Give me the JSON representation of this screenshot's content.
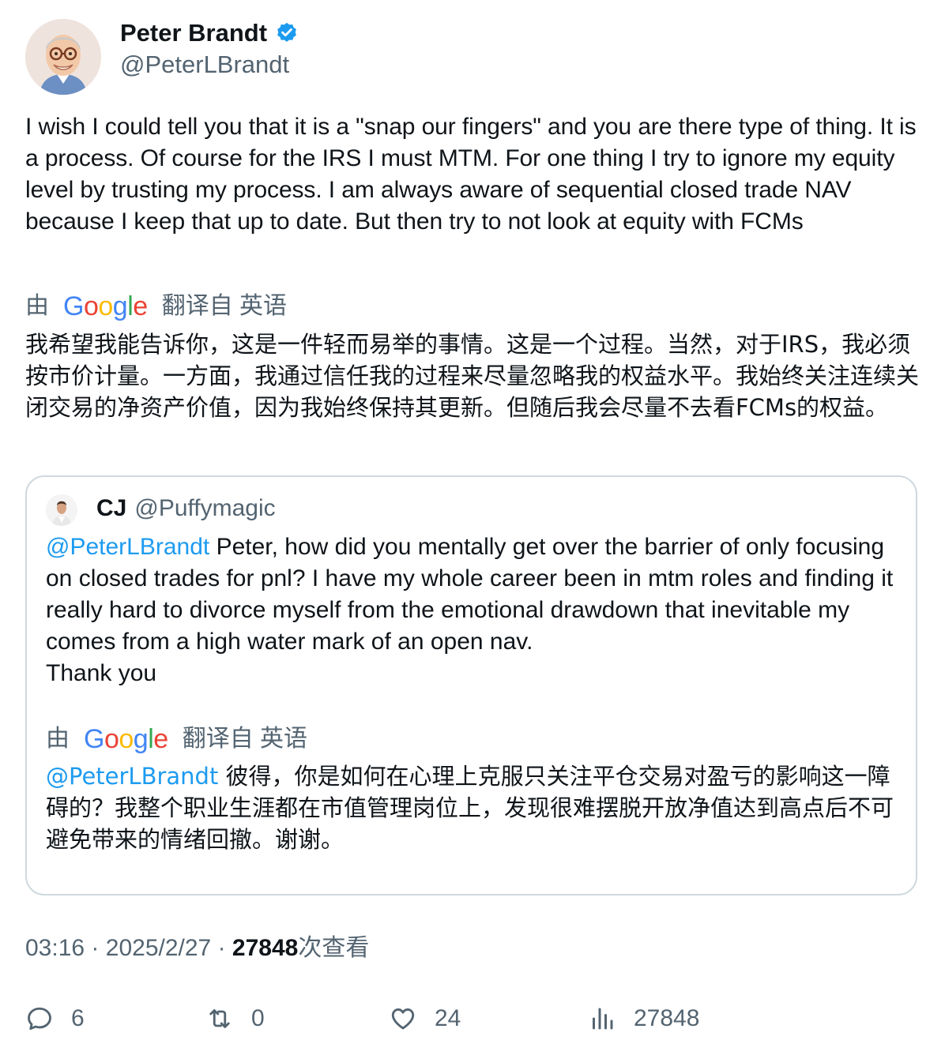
{
  "author": {
    "name": "Peter Brandt",
    "handle": "@PeterLBrandt",
    "verified": true
  },
  "tweet": {
    "text": "I wish I could tell you that it is a \"snap our fingers\" and you are there type of thing. It is a process. Of course for the IRS I must MTM. For one thing I try to ignore my equity level by trusting my process. I am always aware of sequential closed trade NAV because I keep that up to date. But then try to not look at equity with FCMs",
    "translation_label": {
      "by": "由",
      "service": "Google",
      "from": "翻译自 英语"
    },
    "translated_text": "我希望我能告诉你，这是一件轻而易举的事情。这是一个过程。当然，对于IRS，我必须按市价计量。一方面，我通过信任我的过程来尽量忽略我的权益水平。我始终关注连续关闭交易的净资产价值，因为我始终保持其更新。但随后我会尽量不去看FCMs的权益。"
  },
  "quote": {
    "name": "CJ",
    "handle": "@Puffymagic",
    "mention": "@PeterLBrandt",
    "text": " Peter, how did you mentally get over the barrier of only focusing on closed trades for pnl? I have my whole career been in mtm roles and finding it really hard to divorce myself from the emotional drawdown that inevitable my comes from a high water mark of an open nav.\nThank you",
    "translation_label": {
      "by": "由",
      "service": "Google",
      "from": "翻译自 英语"
    },
    "translated_mention": "@PeterLBrandt",
    "translated_text": " 彼得，你是如何在心理上克服只关注平仓交易对盈亏的影响这一障碍的？我整个职业生涯都在市值管理岗位上，发现很难摆脱开放净值达到高点后不可避免带来的情绪回撤。谢谢。"
  },
  "meta": {
    "time": "03:16",
    "separator": "·",
    "date": "2025/2/27",
    "views_count": "27848",
    "views_label": "次查看"
  },
  "actions": {
    "replies": "6",
    "retweets": "0",
    "likes": "24",
    "views": "27848"
  },
  "colors": {
    "link": "#1d9bf0",
    "secondary_text": "#536471",
    "verified": "#1d9bf0",
    "border": "#cfd9de"
  }
}
